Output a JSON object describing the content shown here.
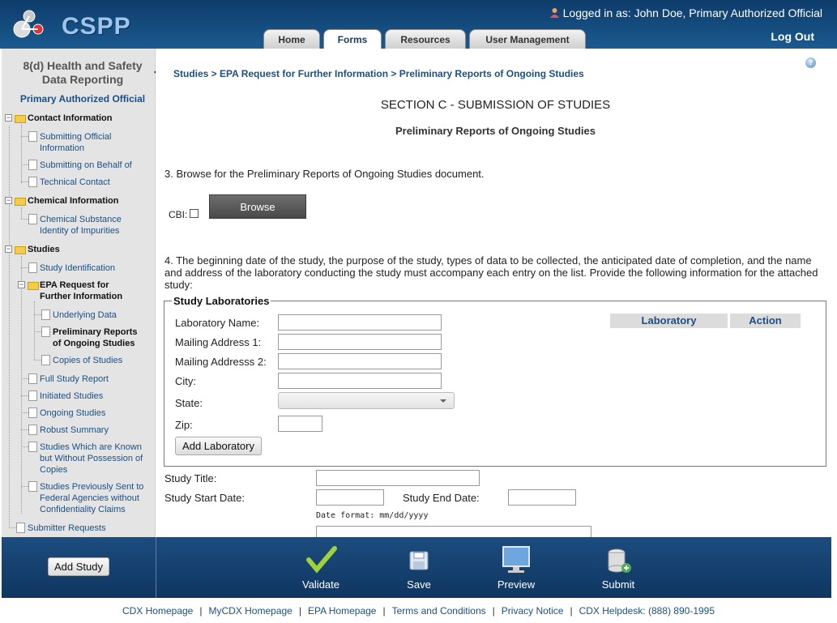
{
  "header": {
    "logo": "CSPP",
    "logged_in": "Logged in as: John Doe, Primary Authorized Official",
    "tabs": [
      "Home",
      "Forms",
      "Resources",
      "User Management"
    ],
    "active_tab": "Forms",
    "logout": "Log Out"
  },
  "sidebar": {
    "title_line1": "8(d) Health and Safety",
    "title_line2": "Data Reporting",
    "role": "Primary Authorized Official",
    "tree": {
      "contact": "Contact Information",
      "submitting_official_1": "Submitting Official",
      "submitting_official_2": "Information",
      "submitting_behalf": "Submitting on Behalf of",
      "technical_contact": "Technical Contact",
      "chemical": "Chemical Information",
      "chem_sub_1": "Chemical Substance",
      "chem_sub_2": "Identity of Impurities",
      "studies": "Studies",
      "study_identification": "Study Identification",
      "epa_request_1": "EPA Request for",
      "epa_request_2": "Further Information",
      "underlying_data": "Underlying Data",
      "prelim_1": "Preliminary Reports",
      "prelim_2": "of Ongoing Studies",
      "copies": "Copies of Studies",
      "full_report": "Full Study Report",
      "initiated": "Initiated Studies",
      "ongoing": "Ongoing Studies",
      "robust": "Robust Summary",
      "known_1": "Studies Which are Known",
      "known_2": "but Without Possession of",
      "known_3": "Copies",
      "prev_1": "Studies Previously Sent to",
      "prev_2": "Federal Agencies without",
      "prev_3": "Confidentiality Claims",
      "submitter_requests": "Submitter Requests"
    }
  },
  "main": {
    "breadcrumb": "Studies > EPA Request for Further Information > Preliminary Reports of Ongoing Studies",
    "section_title": "SECTION C - SUBMISSION OF STUDIES",
    "subtitle": "Preliminary Reports of Ongoing Studies",
    "q3": "3. Browse for the Preliminary Reports of Ongoing Studies document.",
    "cbi_label": "CBI:",
    "browse": "Browse",
    "q4": "4. The beginning date of the study, the purpose of the study, types of data to be collected, the anticipated date of completion, and the name and address of the laboratory conducting the study must accompany each entry on the list. Provide the following information for the attached study:",
    "labs_legend": "Study Laboratories",
    "lab_name": "Laboratory Name:",
    "addr1": "Mailing Address 1:",
    "addr2": "Mailing Addresss 2:",
    "city": "City:",
    "state": "State:",
    "zip": "Zip:",
    "add_lab": "Add Laboratory",
    "col_lab": "Laboratory",
    "col_action": "Action",
    "study_title": "Study Title:",
    "start_date": "Study Start Date:",
    "end_date": "Study End Date:",
    "date_format": "Date format: mm/dd/yyyy"
  },
  "bottom_bar": {
    "add_study": "Add Study",
    "validate": "Validate",
    "save": "Save",
    "preview": "Preview",
    "submit": "Submit"
  },
  "footer": {
    "links": [
      "CDX Homepage",
      "MyCDX Homepage",
      "EPA Homepage",
      "Terms and Conditions",
      "Privacy Notice",
      "CDX Helpdesk: (888) 890-1995"
    ]
  }
}
